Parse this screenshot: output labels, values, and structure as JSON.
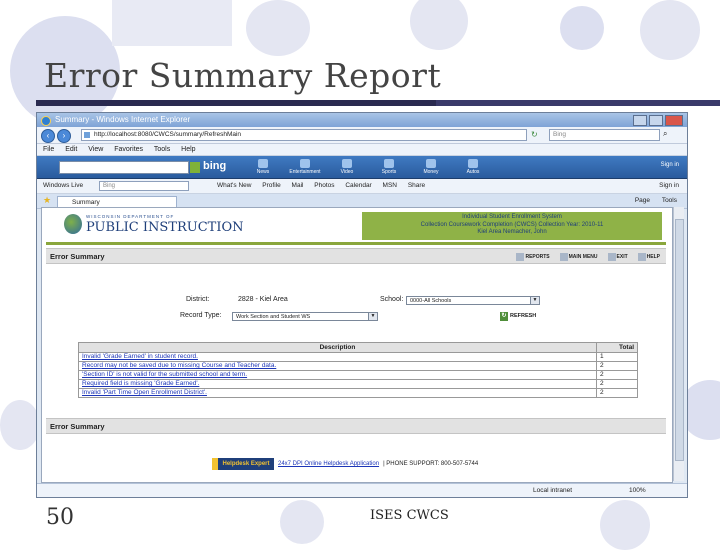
{
  "slide": {
    "title": "Error Summary Report",
    "number": "50",
    "footer": "ISES CWCS"
  },
  "browser": {
    "window_title": "Summary - Windows Internet Explorer",
    "address": "http://localhost:8080/CWCS/summary/RefreshMain",
    "search_placeholder": "Bing",
    "menu": [
      "File",
      "Edit",
      "View",
      "Favorites",
      "Tools",
      "Help"
    ],
    "bing_logo": "bing",
    "bing_items": [
      "News",
      "Entertainment",
      "Video",
      "Sports",
      "Money",
      "Autos"
    ],
    "windows_live": {
      "label": "Windows Live",
      "search_placeholder": "Bing",
      "items": [
        "What's New",
        "Profile",
        "Mail",
        "Photos",
        "Calendar",
        "MSN",
        "Share"
      ],
      "signin": "Sign in"
    },
    "tab_label": "Summary",
    "tab_tools": [
      "Page",
      "Tools"
    ],
    "status": {
      "zone": "Local intranet",
      "zoom": "100%"
    }
  },
  "app": {
    "dept_small": "WISCONSIN DEPARTMENT OF",
    "dept_name": "PUBLIC INSTRUCTION",
    "info_line1": "Individual Student Enrollment System",
    "info_line2": "Collection Coursework Completion (CWCS) Collection Year: 2010-11",
    "info_line3": "Kiel Area   Nemacher, John",
    "section_title": "Error Summary",
    "nav_links": [
      "REPORTS",
      "MAIN MENU",
      "EXIT",
      "HELP"
    ],
    "filters": {
      "district_label": "District:",
      "district_value": "2828 - Kiel Area",
      "school_label": "School:",
      "school_value": "0000-All Schools",
      "record_type_label": "Record Type:",
      "record_type_value": "Work Section and Student WS",
      "refresh_label": "REFRESH"
    },
    "table": {
      "headers": [
        "Description",
        "Total"
      ],
      "rows": [
        {
          "desc": "Invalid 'Grade Earned' in student record.",
          "total": "1"
        },
        {
          "desc": "Record may not be saved due to missing Course and Teacher data.",
          "total": "2"
        },
        {
          "desc": "'Section ID' is not valid for the submitted school and term.",
          "total": "2"
        },
        {
          "desc": "Required field is missing 'Grade Earned'.",
          "total": "2"
        },
        {
          "desc": "Invalid 'Part Time Open Enrollment District'.",
          "total": "2"
        }
      ]
    },
    "section_title_2": "Error Summary",
    "helpdesk_logo": "Helpdesk Expert",
    "helpdesk_link": "24x7 DPI Online Helpdesk Application",
    "helpdesk_phone": " | PHONE SUPPORT: 800-507-5744"
  }
}
